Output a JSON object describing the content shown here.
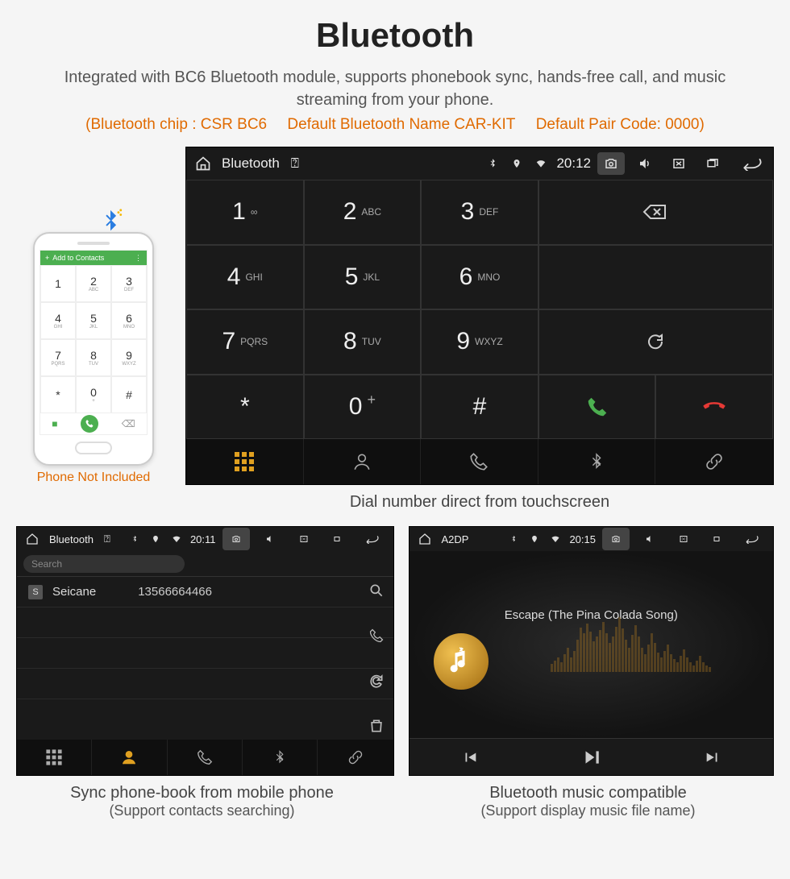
{
  "title": "Bluetooth",
  "subtitle": "Integrated with BC6 Bluetooth module, supports phonebook sync, hands-free call, and music streaming from your phone.",
  "specs": {
    "chip": "(Bluetooth chip : CSR BC6",
    "name": "Default Bluetooth Name CAR-KIT",
    "code": "Default Pair Code: 0000)"
  },
  "phone": {
    "top_label": "Add to Contacts",
    "keys": [
      {
        "n": "1",
        "l": ""
      },
      {
        "n": "2",
        "l": "ABC"
      },
      {
        "n": "3",
        "l": "DEF"
      },
      {
        "n": "4",
        "l": "GHI"
      },
      {
        "n": "5",
        "l": "JKL"
      },
      {
        "n": "6",
        "l": "MNO"
      },
      {
        "n": "7",
        "l": "PQRS"
      },
      {
        "n": "8",
        "l": "TUV"
      },
      {
        "n": "9",
        "l": "WXYZ"
      },
      {
        "n": "*",
        "l": ""
      },
      {
        "n": "0",
        "l": "+"
      },
      {
        "n": "#",
        "l": ""
      }
    ],
    "caption": "Phone Not Included"
  },
  "main": {
    "status": {
      "title": "Bluetooth",
      "time": "20:12"
    },
    "keys": [
      {
        "n": "1",
        "l": "∞"
      },
      {
        "n": "2",
        "l": "ABC"
      },
      {
        "n": "3",
        "l": "DEF"
      },
      {
        "n": "4",
        "l": "GHI"
      },
      {
        "n": "5",
        "l": "JKL"
      },
      {
        "n": "6",
        "l": "MNO"
      },
      {
        "n": "7",
        "l": "PQRS"
      },
      {
        "n": "8",
        "l": "TUV"
      },
      {
        "n": "9",
        "l": "WXYZ"
      },
      {
        "n": "*",
        "l": ""
      },
      {
        "n": "0",
        "l": "+"
      },
      {
        "n": "#",
        "l": ""
      }
    ],
    "caption": "Dial number direct from touchscreen"
  },
  "phonebook": {
    "status": {
      "title": "Bluetooth",
      "time": "20:11"
    },
    "search_placeholder": "Search",
    "contact": {
      "badge": "S",
      "name": "Seicane",
      "number": "13566664466"
    },
    "caption_line1": "Sync phone-book from mobile phone",
    "caption_line2": "(Support contacts searching)"
  },
  "music": {
    "status": {
      "title": "A2DP",
      "time": "20:15"
    },
    "track": "Escape (The Pina Colada Song)",
    "caption_line1": "Bluetooth music compatible",
    "caption_line2": "(Support display music file name)"
  }
}
